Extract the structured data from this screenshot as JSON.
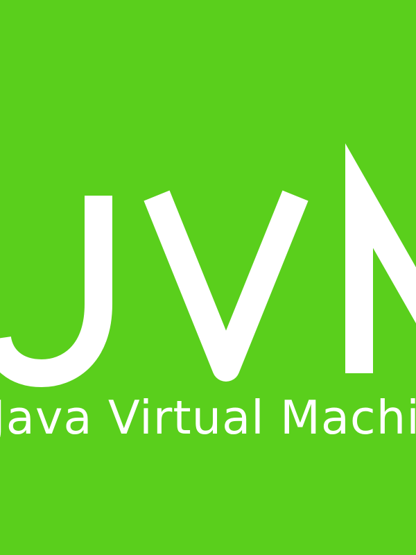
{
  "banner": {
    "background_color": "#5acf1c",
    "text_color": "#ffffff",
    "logo_text": "JVM",
    "subtitle": "Java Virtual Machine"
  }
}
